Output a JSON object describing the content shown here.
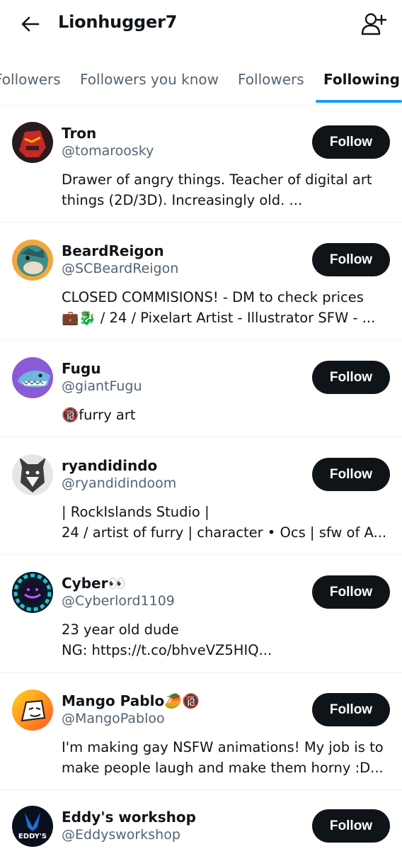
{
  "header": {
    "title": "Lionhugger7",
    "back_icon": "arrow-left-icon",
    "add_icon": "add-user-icon"
  },
  "tabs": [
    {
      "label": "Followers"
    },
    {
      "label": "Followers you know"
    },
    {
      "label": "Followers"
    },
    {
      "label": "Following",
      "active": true
    }
  ],
  "accent_color": "#1d9bf0",
  "users": [
    {
      "name": "Tron",
      "handle": "@tomaroosky",
      "bio": [
        "Drawer of angry things. Teacher of digital art",
        "things (2D/3D). Increasingly old. ..."
      ],
      "button": "Follow"
    },
    {
      "name": "BeardReigon",
      "handle": "@SCBeardReigon",
      "bio": [
        "CLOSED COMMISIONS! - DM to check prices",
        "💼🐉 / 24 / Pixelart Artist - Illustrator SFW - ..."
      ],
      "button": "Follow"
    },
    {
      "name": "Fugu",
      "handle": "@giantFugu",
      "bio": [
        "🔞furry art"
      ],
      "button": "Follow"
    },
    {
      "name": "ryandidindo",
      "handle": "@ryandidindoom",
      "bio": [
        "| RockIslands Studio |",
        "24 / artist of furry | character • Ocs  | sfw of A..."
      ],
      "button": "Follow"
    },
    {
      "name": "Cyber👀",
      "handle": "@Cyberlord1109",
      "bio": [
        "23 year old dude",
        "NG: https://t.co/bhveVZ5HIQ..."
      ],
      "button": "Follow"
    },
    {
      "name": "Mango Pablo🥭🔞",
      "handle": "@MangoPabloo",
      "bio": [
        "I'm making gay NSFW animations! My job is to",
        "make people laugh and make them horny :D..."
      ],
      "button": "Follow"
    },
    {
      "name": "Eddy's workshop",
      "handle": "@Eddysworkshop",
      "bio": [],
      "button": "Follow",
      "avatar_text": "EDDY'S"
    }
  ]
}
